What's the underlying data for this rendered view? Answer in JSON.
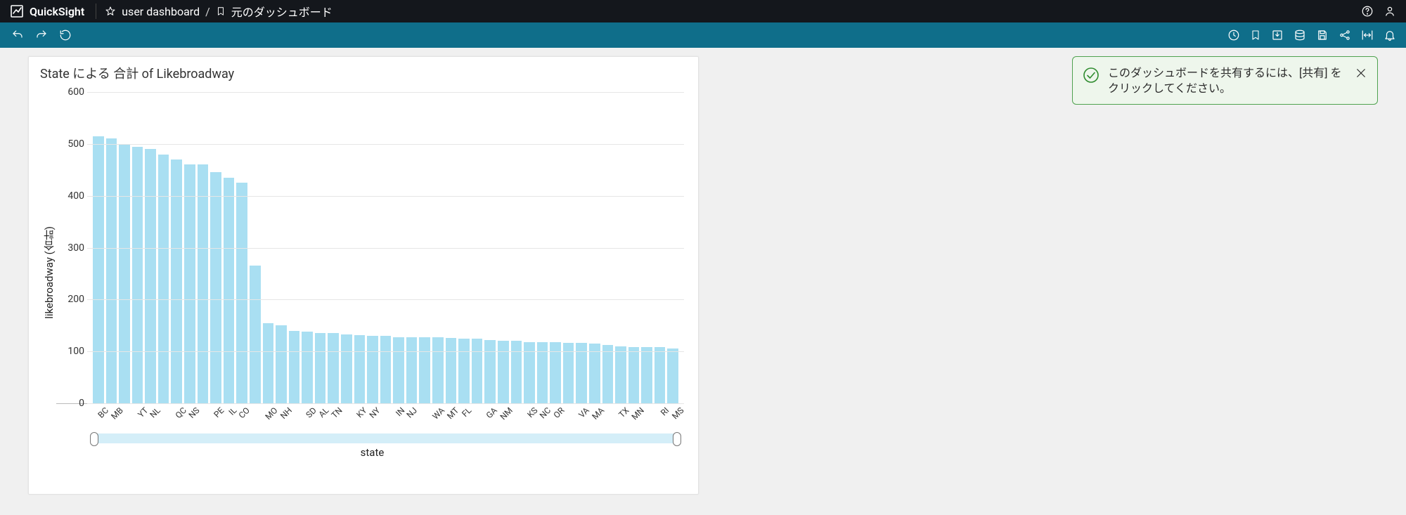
{
  "brand": {
    "name": "QuickSight"
  },
  "breadcrumb": {
    "item1": "user dashboard",
    "sep": "/",
    "item2": "元のダッシュボード"
  },
  "toast": {
    "message": "このダッシュボードを共有するには、[共有] をクリックしてください。"
  },
  "chart_data": {
    "type": "bar",
    "title": "State による 合計 of Likebroadway",
    "xlabel": "state",
    "ylabel": "likebroadway (合計)",
    "ylim": [
      0,
      600
    ],
    "yticks": [
      0,
      100,
      200,
      300,
      400,
      500,
      600
    ],
    "categories": [
      "BC",
      "MB",
      "YT",
      "NL",
      "QC",
      "NS",
      "PE",
      "IL",
      "CO",
      "MO",
      "NH",
      "SD",
      "AL",
      "TN",
      "KY",
      "NY",
      "IN",
      "NJ",
      "WA",
      "MT",
      "FL",
      "GA",
      "NM",
      "KS",
      "NC",
      "OR",
      "VA",
      "MA",
      "TX",
      "MN",
      "RI",
      "MS"
    ],
    "values": [
      515,
      510,
      500,
      495,
      490,
      480,
      470,
      460,
      460,
      445,
      435,
      425,
      265,
      155,
      150,
      140,
      138,
      135,
      135,
      133,
      132,
      130,
      130,
      128,
      128,
      128,
      128,
      126,
      126,
      125,
      124,
      123,
      122,
      120,
      120,
      120,
      119,
      118,
      118,
      118,
      117,
      116,
      115,
      112,
      108
    ]
  },
  "chart_fix": {
    "categories": [
      "BC",
      "MB",
      "YT",
      "NL",
      "QC",
      "NS",
      "PE",
      "IL",
      "CO",
      "MO",
      "NH",
      "SD",
      "AL",
      "TN",
      "KY",
      "NY",
      "IN",
      "NJ",
      "WA",
      "MT",
      "FL",
      "GA",
      "NM",
      "KS",
      "NC",
      "OR",
      "VA",
      "MA",
      "TX",
      "MN",
      "RI",
      "MS"
    ],
    "values": [
      515,
      510,
      500,
      495,
      490,
      480,
      470,
      460,
      460,
      445,
      435,
      425,
      265,
      155,
      150,
      140,
      138,
      135,
      135,
      133,
      132,
      130,
      130,
      128,
      128,
      128,
      128,
      126,
      125,
      124,
      122,
      120,
      120,
      118,
      118,
      118,
      117,
      116,
      115,
      112,
      110,
      108,
      108,
      108,
      106
    ]
  }
}
